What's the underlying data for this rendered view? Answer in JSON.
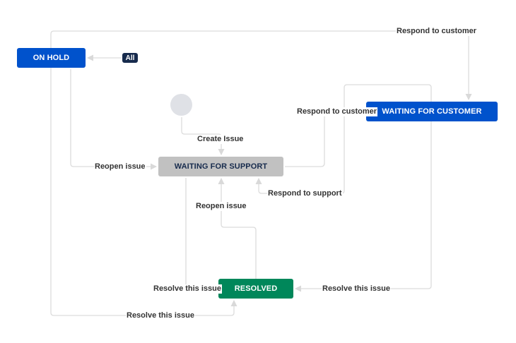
{
  "statuses": {
    "on_hold": "ON HOLD",
    "waiting_for_customer": "WAITING FOR CUSTOMER",
    "waiting_for_support": "WAITING FOR SUPPORT",
    "resolved": "RESOLVED"
  },
  "global_transition_badge": "All",
  "transitions": {
    "respond_to_customer_top": "Respond to customer",
    "respond_to_customer_mid": "Respond to customer",
    "create_issue": "Create Issue",
    "reopen_issue_left": "Reopen issue",
    "respond_to_support": "Respond to support",
    "reopen_issue_mid": "Reopen issue",
    "resolve_this_issue_left": "Resolve this issue",
    "resolve_this_issue_right": "Resolve this issue",
    "resolve_this_issue_bottom": "Resolve this issue"
  },
  "colors": {
    "status_blue": "#0052cc",
    "status_gray": "#c1c1c1",
    "status_green": "#00875a",
    "start_circle": "#dfe1e6",
    "badge_dark": "#172b4d",
    "edge_line": "#dcdcdc"
  }
}
